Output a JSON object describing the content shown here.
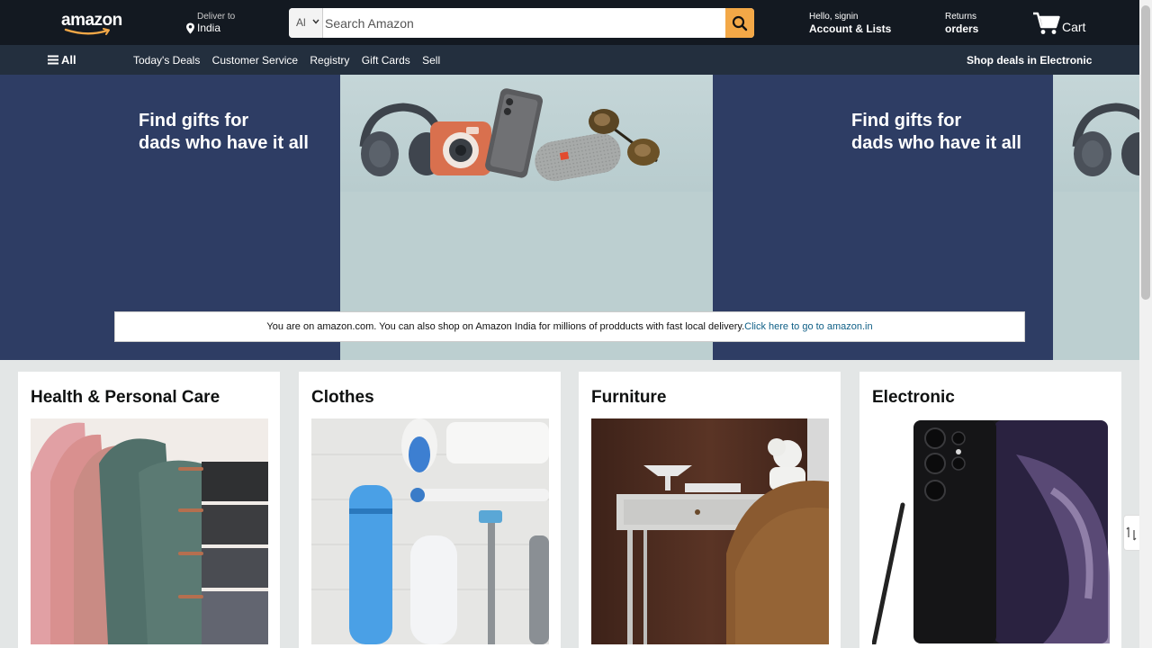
{
  "header": {
    "logo_text": "amazon",
    "deliver_label": "Deliver to",
    "deliver_value": "India",
    "search_category": "Al",
    "search_placeholder": "Search Amazon",
    "account_line1": "Hello, signin",
    "account_line2": "Account & Lists",
    "returns_line1": "Returns",
    "returns_line2": "orders",
    "cart_label": "Cart"
  },
  "subnav": {
    "all_label": "All",
    "links": [
      "Today's Deals",
      "Customer Service",
      "Registry",
      "Gift Cards",
      "Sell"
    ],
    "promo": "Shop deals in Electronic"
  },
  "hero": {
    "headline_line1": "Find gifts for",
    "headline_line2": "dads who have it all",
    "notice_text": "You are on amazon.com. You can also shop on Amazon India for millions of prodducts with fast local delivery.",
    "notice_link": "Click here to go to amazon.in"
  },
  "cards": [
    {
      "title": "Health & Personal Care",
      "image": "folded-towels"
    },
    {
      "title": "Clothes",
      "image": "toiletries-flatlay"
    },
    {
      "title": "Furniture",
      "image": "desk-and-chair"
    },
    {
      "title": "Electronic",
      "image": "smartphone-with-stylus"
    }
  ],
  "colors": {
    "nav_bg": "#131921",
    "subnav_bg": "#232f3e",
    "hero_bg": "#2e3d64",
    "search_button": "#f3a847",
    "link": "#0f5f86"
  }
}
